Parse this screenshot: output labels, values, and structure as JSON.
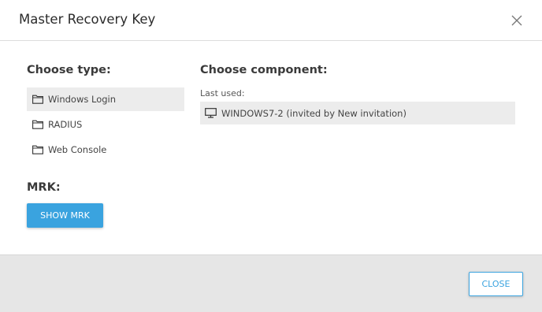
{
  "dialog": {
    "title": "Master Recovery Key",
    "close_icon": "close-icon"
  },
  "choose_type": {
    "heading": "Choose type:",
    "items": [
      {
        "label": "Windows Login",
        "icon": "folder-icon",
        "selected": true
      },
      {
        "label": "RADIUS",
        "icon": "folder-icon",
        "selected": false
      },
      {
        "label": "Web Console",
        "icon": "folder-icon",
        "selected": false
      }
    ]
  },
  "choose_component": {
    "heading": "Choose component:",
    "last_used_label": "Last used:",
    "items": [
      {
        "label": "WINDOWS7-2 (invited by New invitation)",
        "icon": "monitor-icon"
      }
    ]
  },
  "mrk": {
    "heading": "MRK:",
    "show_button_label": "SHOW MRK"
  },
  "footer": {
    "close_button_label": "CLOSE"
  },
  "colors": {
    "accent": "#3aa3df",
    "selected_bg": "#ececec",
    "footer_bg": "#e6e6e6"
  }
}
